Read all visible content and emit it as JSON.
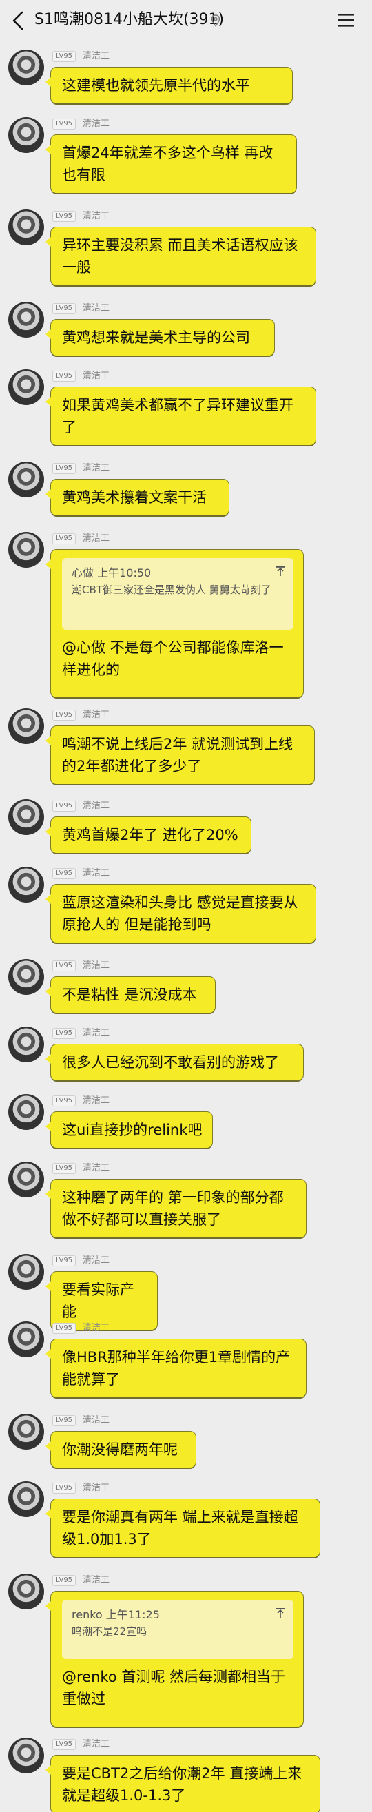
{
  "header": {
    "title": "S1鸣潮0814小船大坎(391)"
  },
  "sender": {
    "level": "LV95",
    "role": "清洁工"
  },
  "messages": [
    {
      "text": "这建模也就领先原半代的水平"
    },
    {
      "text": "首爆24年就差不多这个鸟样 再改也有限"
    },
    {
      "text": "异环主要没积累 而且美术话语权应该一般"
    },
    {
      "text": "黄鸡想来就是美术主导的公司"
    },
    {
      "text": "如果黄鸡美术都赢不了异环建议重开了"
    },
    {
      "text": "黄鸡美术攥着文案干活"
    },
    {
      "quote": {
        "author": "心做",
        "time": "上午10:50",
        "text": "潮CBT御三家还全是黑发伪人 舅舅太苛刻了"
      },
      "text": "@心做 不是每个公司都能像库洛一样进化的"
    },
    {
      "text": "鸣潮不说上线后2年 就说测试到上线的2年都进化了多少了"
    },
    {
      "text": "黄鸡首爆2年了 进化了20%"
    },
    {
      "text": "蓝原这渲染和头身比 感觉是直接要从原抢人的 但是能抢到吗"
    },
    {
      "text": "不是粘性 是沉没成本"
    },
    {
      "text": "很多人已经沉到不敢看别的游戏了"
    },
    {
      "text": "这ui直接抄的relink吧"
    },
    {
      "text": "这种磨了两年的 第一印象的部分都做不好都可以直接关服了"
    },
    {
      "text": "要看实际产能"
    },
    {
      "text": "像HBR那种半年给你更1章剧情的产能就算了"
    },
    {
      "text": "你潮没得磨两年呢"
    },
    {
      "text": "要是你潮真有两年 端上来就是直接超级1.0加1.3了"
    },
    {
      "quote": {
        "author": "renko",
        "time": "上午11:25",
        "text": "鸣潮不是22宣吗"
      },
      "text": "@renko 首测呢 然后每测都相当于重做过"
    },
    {
      "text": "要是CBT2之后给你潮2年 直接端上来就是超级1.0-1.3了"
    }
  ],
  "colors": {
    "bubble": "#f5ec27",
    "quote": "#f8f2b3",
    "background": "#ededed"
  },
  "icons": {
    "back": "chevron-left-icon",
    "location": "location-pin-icon",
    "menu": "hamburger-menu-icon",
    "quote_pin": "pin-icon"
  }
}
